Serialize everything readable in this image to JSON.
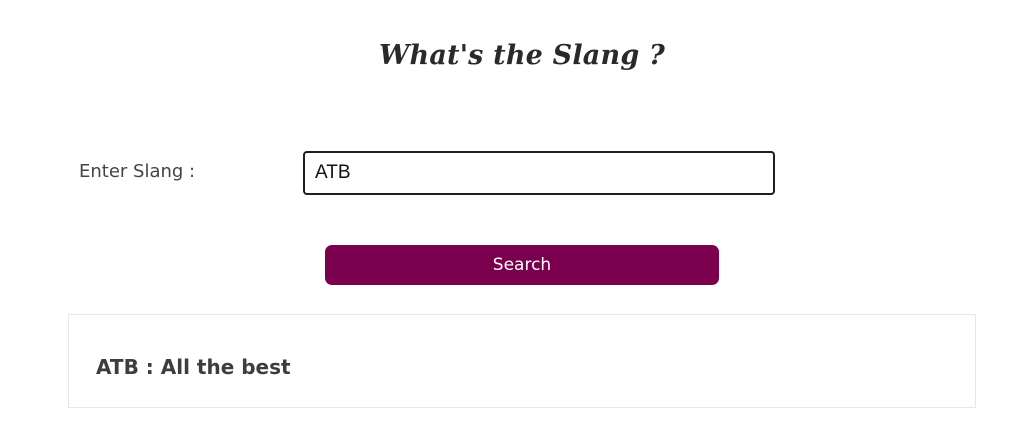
{
  "header": {
    "title": "What's the Slang ?"
  },
  "form": {
    "label": "Enter Slang :",
    "input_value": "ATB",
    "search_label": "Search"
  },
  "result": {
    "text": "ATB : All the best"
  },
  "colors": {
    "button_bg": "#7b004e",
    "button_text": "#ffffff",
    "input_border": "#1e1e1e",
    "result_border": "#e6e6e6"
  }
}
